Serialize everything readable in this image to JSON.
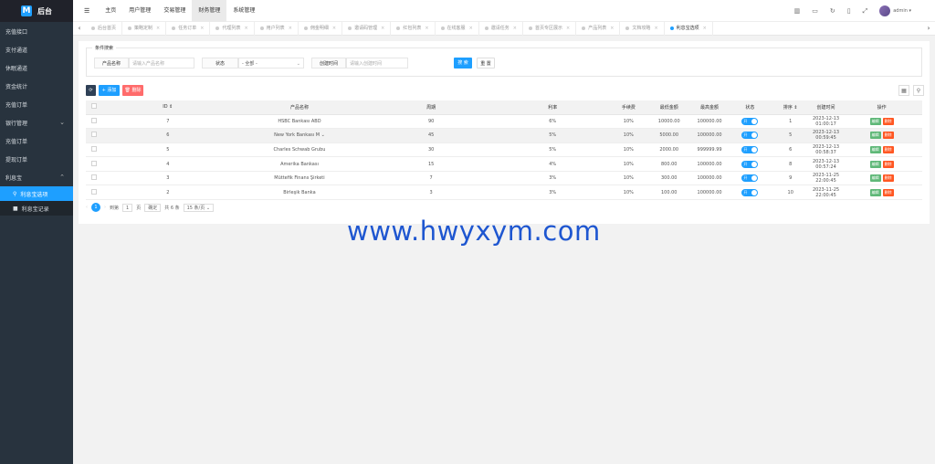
{
  "brand": {
    "logo_letter": "M",
    "title": "后台"
  },
  "sidebar": {
    "items": [
      {
        "label": "充值接口"
      },
      {
        "label": "支付通道"
      },
      {
        "label": "休眠通道"
      },
      {
        "label": "资金统计"
      },
      {
        "label": "充值订单"
      },
      {
        "label": "银行管理",
        "chevron": "⌄"
      },
      {
        "label": "充值订单"
      },
      {
        "label": "提现订单"
      },
      {
        "label": "利息宝",
        "chevron": "⌃"
      }
    ],
    "sub": [
      {
        "label": "利息宝选项",
        "icon": "⚲"
      },
      {
        "label": "利息宝记录",
        "icon": "■"
      }
    ]
  },
  "topbar": {
    "menu_icon": "☰",
    "nav": [
      "主页",
      "用户管理",
      "交易管理",
      "财务管理",
      "系统管理"
    ],
    "icons": [
      "▥",
      "▭",
      "↻",
      "▯",
      "⤢"
    ],
    "user": "admin ▾"
  },
  "tabs": {
    "left_arrow": "‹",
    "right_arrow": "›",
    "items": [
      "后台首页",
      "策略定制",
      "任务订单",
      "代理列表",
      "用户列表",
      "佣金明细",
      "邀请码管理",
      "红包列表",
      "在线客服",
      "邀请任务",
      "首页专区展示",
      "产品列表",
      "文档攻略",
      "利息宝选项"
    ],
    "close": "×"
  },
  "search": {
    "legend": "条件搜索",
    "product_label": "产品名称",
    "product_placeholder": "请输入产品名称",
    "status_label": "状态",
    "status_value": "- 全部 -",
    "created_label": "创建时间",
    "created_placeholder": "请输入创建时间",
    "search_btn": "搜 索",
    "reset_btn": "重 置"
  },
  "toolbar": {
    "refresh": "⟳",
    "add": "+ 添加",
    "delete": "🗑 删除",
    "cols_icon": "▦",
    "search_icon": "⚲"
  },
  "table": {
    "headers": [
      "ID ⇕",
      "产品名称",
      "周期",
      "利率",
      "手续费",
      "最低金额",
      "最高金额",
      "状态",
      "排序 ⇕",
      "创建时间",
      "操作"
    ],
    "rows": [
      {
        "id": "7",
        "name": "HSBC Bankası ABD",
        "period": "90",
        "rate": "6%",
        "fee": "10%",
        "min": "10000.00",
        "max": "100000.00",
        "sort": "1",
        "created": "2023-12-13 01:00:17"
      },
      {
        "id": "6",
        "name": "New York Bankası M",
        "period": "45",
        "rate": "5%",
        "fee": "10%",
        "min": "5000.00",
        "max": "100000.00",
        "sort": "5",
        "created": "2023-12-13 00:59:45"
      },
      {
        "id": "5",
        "name": "Charles Schwab Grubu",
        "period": "30",
        "rate": "5%",
        "fee": "10%",
        "min": "2000.00",
        "max": "999999.99",
        "sort": "6",
        "created": "2023-12-13 00:58:37"
      },
      {
        "id": "4",
        "name": "Amerika Bankası",
        "period": "15",
        "rate": "4%",
        "fee": "10%",
        "min": "800.00",
        "max": "100000.00",
        "sort": "8",
        "created": "2023-12-13 00:57:24"
      },
      {
        "id": "3",
        "name": "Müttefik Finans Şirketi",
        "period": "7",
        "rate": "3%",
        "fee": "10%",
        "min": "300.00",
        "max": "100000.00",
        "sort": "9",
        "created": "2023-11-25 22:00:45"
      },
      {
        "id": "2",
        "name": "Birleşik Banka",
        "period": "3",
        "rate": "3%",
        "fee": "10%",
        "min": "100.00",
        "max": "100000.00",
        "sort": "10",
        "created": "2023-11-25 22:00:45"
      }
    ],
    "switch_label": "开",
    "edit_label": "编辑",
    "del_label": "删除"
  },
  "pager": {
    "prev": "‹",
    "page": "1",
    "next": "›",
    "goto": "到第",
    "input": "1",
    "unit": "页",
    "confirm": "确定",
    "total": "共 6 条",
    "per_page": "15 条/页 ⌄"
  },
  "watermark": "www.hwyxym.com"
}
